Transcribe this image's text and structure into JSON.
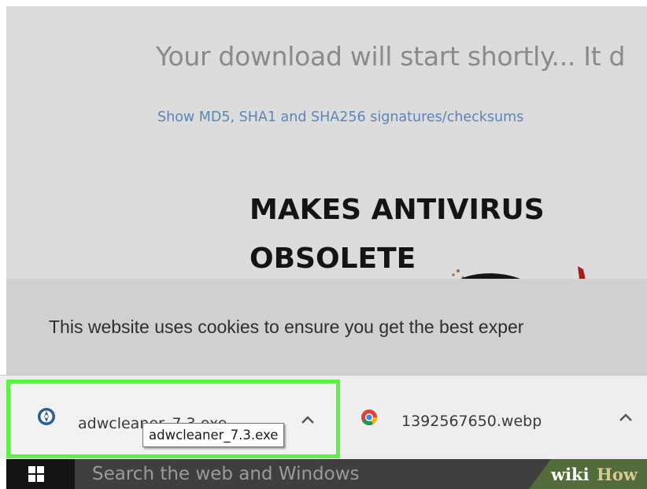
{
  "page": {
    "download_message": "Your download will start shortly... It d",
    "checksums_link": "Show MD5, SHA1 and SHA256 signatures/checksums",
    "ad": {
      "line1": "MAKES ANTIVIRUS",
      "line2": "OBSOLETE"
    }
  },
  "cookie_banner": {
    "text": "This website uses cookies to ensure you get the best exper"
  },
  "download_shelf": {
    "items": [
      {
        "filename": "adwcleaner_7.3.exe",
        "icon": "adwcleaner-icon",
        "highlighted": true,
        "highlight_color": "#5ef046"
      },
      {
        "filename": "1392567650.webp",
        "icon": "chrome-icon",
        "highlighted": false
      }
    ],
    "tooltip": "adwcleaner_7.3.exe"
  },
  "taskbar": {
    "search_placeholder": "Search the web and Windows"
  },
  "watermark": {
    "wiki": "wiki",
    "how": "How"
  },
  "colors": {
    "page_background": "#dcdcdc",
    "link": "#5b84b9",
    "taskbar": "#1d1d1d",
    "search_box": "#3f3f3f"
  }
}
